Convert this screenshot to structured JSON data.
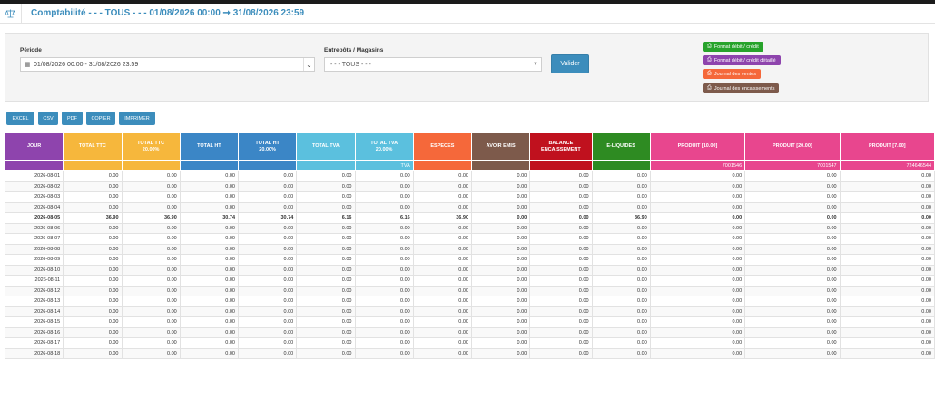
{
  "header": {
    "title": "Comptabilité - - - TOUS - - - 01/08/2026 00:00 ➞ 31/08/2026 23:59",
    "icon": "balance-scale-icon"
  },
  "filters": {
    "periode_label": "Période",
    "periode_value": "01/08/2026 00:00 - 31/08/2026 23:59",
    "store_label": "Entrepôts / Magasins",
    "store_value": "- - - TOUS - - -",
    "submit_label": "Valider"
  },
  "reports": [
    {
      "label": "Format débit / crédit",
      "color": "#27a32b"
    },
    {
      "label": "Format débit / crédit détaillé",
      "color": "#8e44ad"
    },
    {
      "label": "Journal des ventes",
      "color": "#f5683a"
    },
    {
      "label": "Journal des encaissements",
      "color": "#7d5a4b"
    }
  ],
  "export_buttons": [
    "EXCEL",
    "CSV",
    "PDF",
    "COPIER",
    "IMPRIMER"
  ],
  "table": {
    "columns": [
      {
        "title": "JOUR",
        "sub": "",
        "color": "#8e44ad",
        "sub_value": ""
      },
      {
        "title": "TOTAL TTC",
        "sub": "",
        "color": "#f6b73c",
        "sub_value": ""
      },
      {
        "title": "TOTAL TTC",
        "sub": "20.00%",
        "color": "#f6b73c",
        "sub_value": ""
      },
      {
        "title": "TOTAL HT",
        "sub": "",
        "color": "#3b86c6",
        "sub_value": ""
      },
      {
        "title": "TOTAL HT",
        "sub": "20.00%",
        "color": "#3b86c6",
        "sub_value": ""
      },
      {
        "title": "TOTAL TVA",
        "sub": "",
        "color": "#5bc0de",
        "sub_value": ""
      },
      {
        "title": "TOTAL TVA",
        "sub": "20.00%",
        "color": "#5bc0de",
        "sub_value": "TVA"
      },
      {
        "title": "ESPECES",
        "sub": "",
        "color": "#f5683a",
        "sub_value": ""
      },
      {
        "title": "AVOIR EMIS",
        "sub": "",
        "color": "#7d5a4b",
        "sub_value": ""
      },
      {
        "title": "BALANCE",
        "sub": "ENCAISSEMENT",
        "color": "#c0111e",
        "sub_value": ""
      },
      {
        "title": "E-LIQUIDES",
        "sub": "",
        "color": "#2e8b22",
        "sub_value": ""
      },
      {
        "title": "PRODUIT [10.00]",
        "sub": "",
        "color": "#e8468e",
        "sub_value": "7001546"
      },
      {
        "title": "PRODUIT [20.00]",
        "sub": "",
        "color": "#e8468e",
        "sub_value": "7001547"
      },
      {
        "title": "PRODUIT [7.00]",
        "sub": "",
        "color": "#e8468e",
        "sub_value": "724646544"
      }
    ],
    "rows": [
      [
        "2026-08-01",
        "0.00",
        "0.00",
        "0.00",
        "0.00",
        "0.00",
        "0.00",
        "0.00",
        "0.00",
        "0.00",
        "0.00",
        "0.00",
        "0.00",
        "0.00"
      ],
      [
        "2026-08-02",
        "0.00",
        "0.00",
        "0.00",
        "0.00",
        "0.00",
        "0.00",
        "0.00",
        "0.00",
        "0.00",
        "0.00",
        "0.00",
        "0.00",
        "0.00"
      ],
      [
        "2026-08-03",
        "0.00",
        "0.00",
        "0.00",
        "0.00",
        "0.00",
        "0.00",
        "0.00",
        "0.00",
        "0.00",
        "0.00",
        "0.00",
        "0.00",
        "0.00"
      ],
      [
        "2026-08-04",
        "0.00",
        "0.00",
        "0.00",
        "0.00",
        "0.00",
        "0.00",
        "0.00",
        "0.00",
        "0.00",
        "0.00",
        "0.00",
        "0.00",
        "0.00"
      ],
      [
        "2026-08-05",
        "36.90",
        "36.90",
        "30.74",
        "30.74",
        "6.16",
        "6.16",
        "36.90",
        "0.00",
        "0.00",
        "36.90",
        "0.00",
        "0.00",
        "0.00"
      ],
      [
        "2026-08-06",
        "0.00",
        "0.00",
        "0.00",
        "0.00",
        "0.00",
        "0.00",
        "0.00",
        "0.00",
        "0.00",
        "0.00",
        "0.00",
        "0.00",
        "0.00"
      ],
      [
        "2026-08-07",
        "0.00",
        "0.00",
        "0.00",
        "0.00",
        "0.00",
        "0.00",
        "0.00",
        "0.00",
        "0.00",
        "0.00",
        "0.00",
        "0.00",
        "0.00"
      ],
      [
        "2026-08-08",
        "0.00",
        "0.00",
        "0.00",
        "0.00",
        "0.00",
        "0.00",
        "0.00",
        "0.00",
        "0.00",
        "0.00",
        "0.00",
        "0.00",
        "0.00"
      ],
      [
        "2026-08-09",
        "0.00",
        "0.00",
        "0.00",
        "0.00",
        "0.00",
        "0.00",
        "0.00",
        "0.00",
        "0.00",
        "0.00",
        "0.00",
        "0.00",
        "0.00"
      ],
      [
        "2026-08-10",
        "0.00",
        "0.00",
        "0.00",
        "0.00",
        "0.00",
        "0.00",
        "0.00",
        "0.00",
        "0.00",
        "0.00",
        "0.00",
        "0.00",
        "0.00"
      ],
      [
        "2026-08-11",
        "0.00",
        "0.00",
        "0.00",
        "0.00",
        "0.00",
        "0.00",
        "0.00",
        "0.00",
        "0.00",
        "0.00",
        "0.00",
        "0.00",
        "0.00"
      ],
      [
        "2026-08-12",
        "0.00",
        "0.00",
        "0.00",
        "0.00",
        "0.00",
        "0.00",
        "0.00",
        "0.00",
        "0.00",
        "0.00",
        "0.00",
        "0.00",
        "0.00"
      ],
      [
        "2026-08-13",
        "0.00",
        "0.00",
        "0.00",
        "0.00",
        "0.00",
        "0.00",
        "0.00",
        "0.00",
        "0.00",
        "0.00",
        "0.00",
        "0.00",
        "0.00"
      ],
      [
        "2026-08-14",
        "0.00",
        "0.00",
        "0.00",
        "0.00",
        "0.00",
        "0.00",
        "0.00",
        "0.00",
        "0.00",
        "0.00",
        "0.00",
        "0.00",
        "0.00"
      ],
      [
        "2026-08-15",
        "0.00",
        "0.00",
        "0.00",
        "0.00",
        "0.00",
        "0.00",
        "0.00",
        "0.00",
        "0.00",
        "0.00",
        "0.00",
        "0.00",
        "0.00"
      ],
      [
        "2026-08-16",
        "0.00",
        "0.00",
        "0.00",
        "0.00",
        "0.00",
        "0.00",
        "0.00",
        "0.00",
        "0.00",
        "0.00",
        "0.00",
        "0.00",
        "0.00"
      ],
      [
        "2026-08-17",
        "0.00",
        "0.00",
        "0.00",
        "0.00",
        "0.00",
        "0.00",
        "0.00",
        "0.00",
        "0.00",
        "0.00",
        "0.00",
        "0.00",
        "0.00"
      ],
      [
        "2026-08-18",
        "0.00",
        "0.00",
        "0.00",
        "0.00",
        "0.00",
        "0.00",
        "0.00",
        "0.00",
        "0.00",
        "0.00",
        "0.00",
        "0.00",
        "0.00"
      ]
    ]
  }
}
